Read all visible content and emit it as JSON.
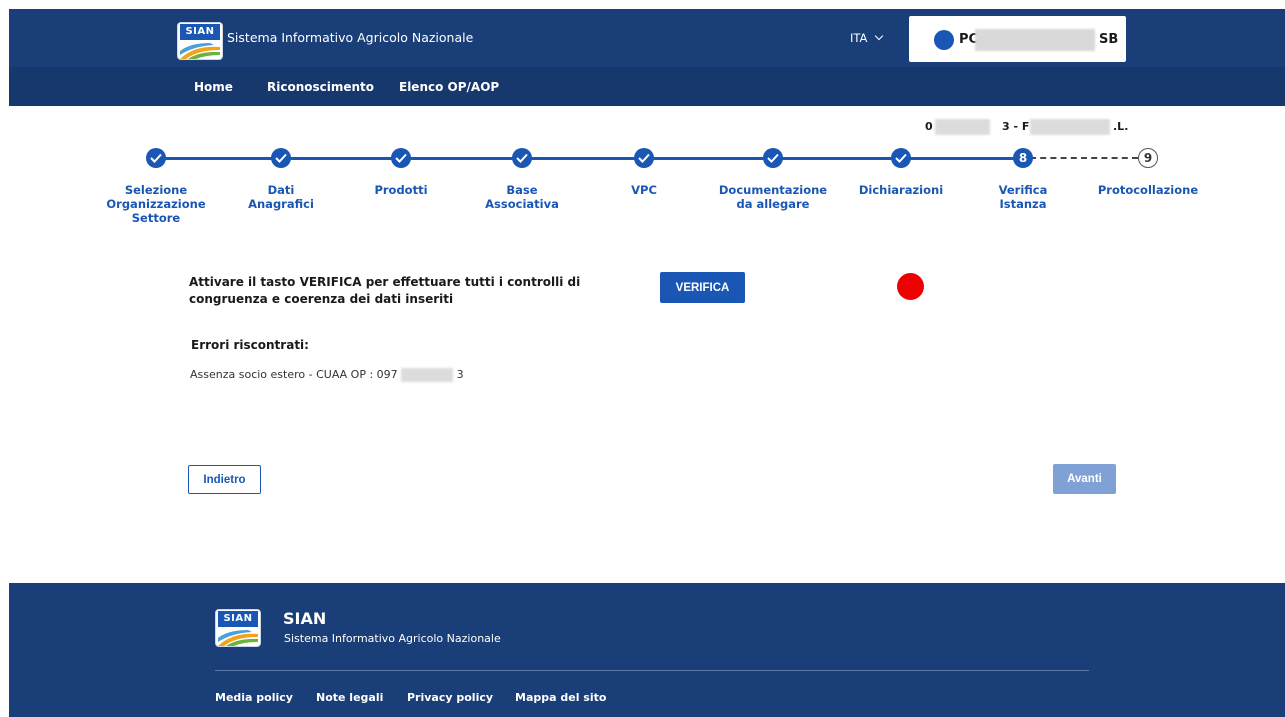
{
  "header": {
    "logo_text": "SIAN",
    "title": "Sistema Informativo Agricolo Nazionale",
    "language": "ITA",
    "user_name_start": "PC",
    "user_name_end": "SB"
  },
  "nav": {
    "items": [
      "Home",
      "Riconoscimento",
      "Elenco OP/AOP"
    ]
  },
  "organization": {
    "code_start": "0",
    "mid": "3 - F",
    "suffix": ".L."
  },
  "stepper": {
    "steps": [
      {
        "label": "Selezione Organizzazione Settore",
        "state": "done"
      },
      {
        "label": "Dati Anagrafici",
        "state": "done"
      },
      {
        "label": "Prodotti",
        "state": "done"
      },
      {
        "label": "Base Associativa",
        "state": "done"
      },
      {
        "label": "VPC",
        "state": "done"
      },
      {
        "label": "Documentazione da allegare",
        "state": "done"
      },
      {
        "label": "Dichiarazioni",
        "state": "done"
      },
      {
        "label": "Verifica Istanza",
        "state": "active",
        "number": "8"
      },
      {
        "label": "Protocollazione",
        "state": "pending",
        "number": "9"
      }
    ]
  },
  "verify": {
    "instruction": "Attivare il tasto VERIFICA per effettuare tutti i controlli di congruenza e coerenza dei dati inseriti",
    "button_label": "VERIFICA",
    "status_color": "#ee0000"
  },
  "errors": {
    "title": "Errori riscontrati:",
    "items": [
      "Assenza socio estero - CUAA OP : 097",
      "3"
    ]
  },
  "actions": {
    "back_label": "Indietro",
    "next_label": "Avanti"
  },
  "footer": {
    "logo_text": "SIAN",
    "title": "SIAN",
    "subtitle": "Sistema Informativo Agricolo Nazionale",
    "links": [
      "Media policy",
      "Note legali",
      "Privacy policy",
      "Mappa del sito"
    ]
  },
  "colors": {
    "primary": "#1a57b5",
    "header_bg": "#1a3e78",
    "nav_bg": "#17386d",
    "error_dot": "#ee0000"
  }
}
